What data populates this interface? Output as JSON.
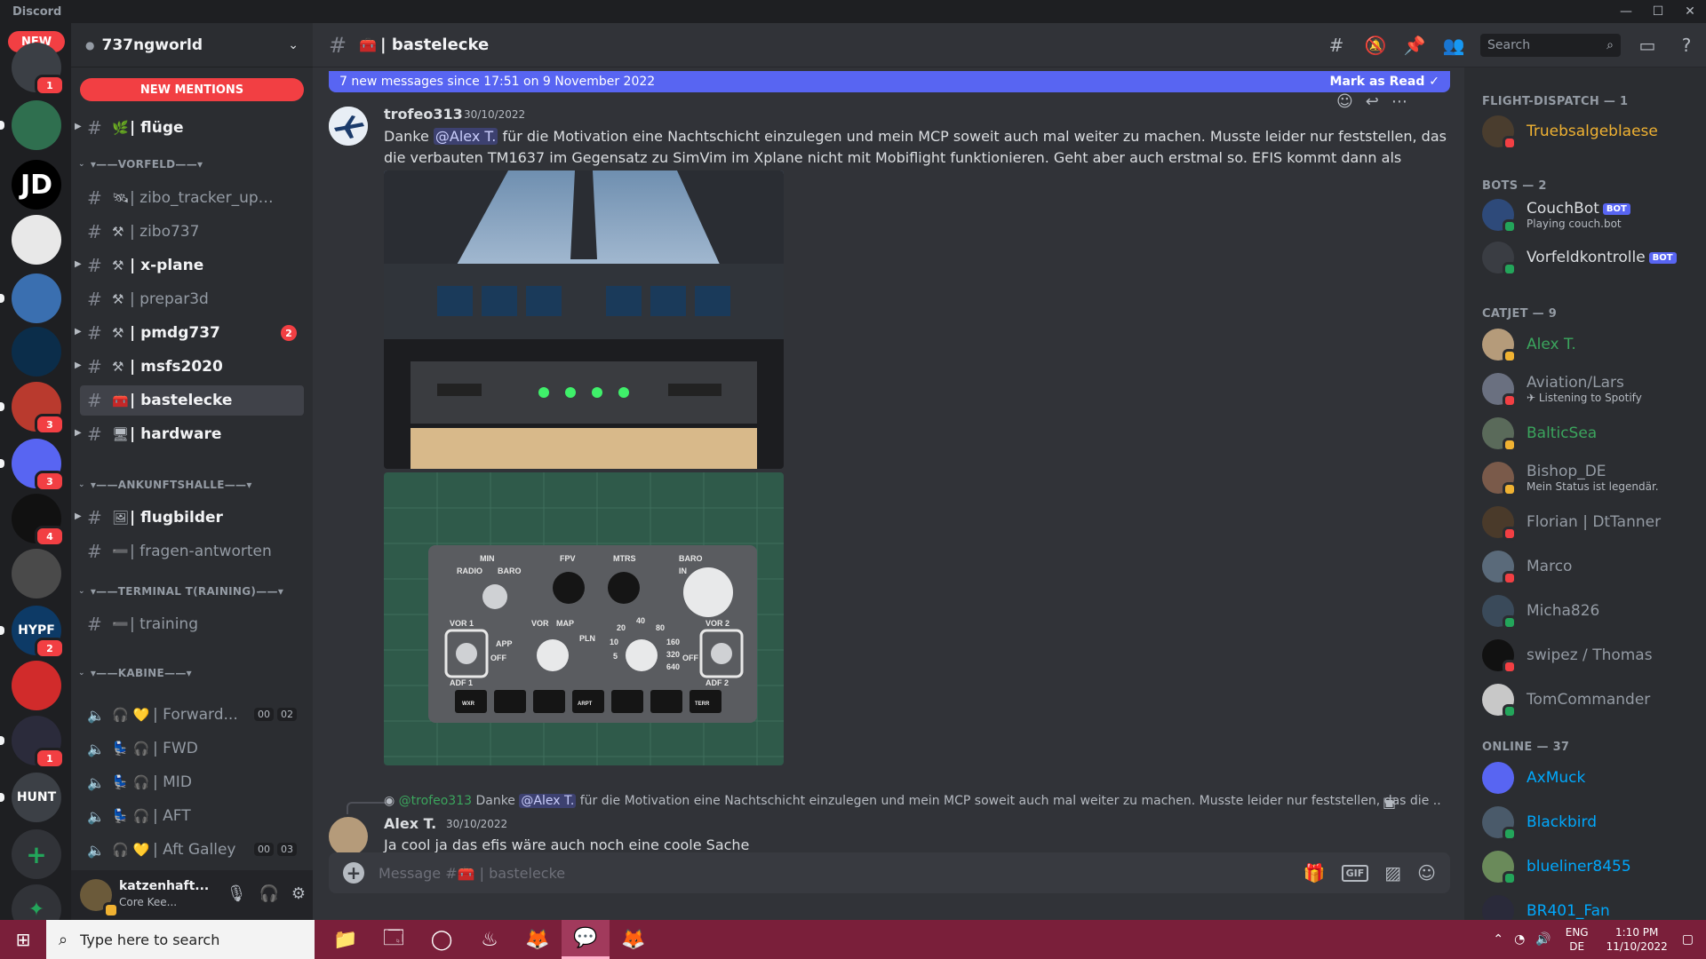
{
  "window": {
    "app_name": "Discord",
    "minimize": "—",
    "maximize": "☐",
    "close": "✕"
  },
  "rail": {
    "new_label": "NEW",
    "servers": [
      {
        "text": "",
        "color": "#3b3f45",
        "badge": "1"
      },
      {
        "text": "",
        "color": "#2f6f4f",
        "badge": ""
      },
      {
        "text": "JD",
        "color": "#000000",
        "badge": ""
      },
      {
        "text": "",
        "color": "#e8e8e8",
        "badge": ""
      },
      {
        "text": "",
        "color": "#3a6fb0",
        "badge": ""
      },
      {
        "text": "",
        "color": "#0b2d4a",
        "badge": ""
      },
      {
        "text": "",
        "color": "#b93a2e",
        "badge": "3"
      },
      {
        "text": "",
        "color": "#5865f2",
        "badge": "3"
      },
      {
        "text": "",
        "color": "#111111",
        "badge": "4"
      },
      {
        "text": "",
        "color": "#4a4a4a",
        "badge": ""
      },
      {
        "text": "HYPF",
        "color": "#0d3a66",
        "badge": "2"
      },
      {
        "text": "",
        "color": "#d12b2b",
        "badge": ""
      },
      {
        "text": "",
        "color": "#2b2b3b",
        "badge": "1"
      },
      {
        "text": "HUNT",
        "color": "#3c4046",
        "badge": ""
      }
    ],
    "add_server": "+",
    "explore": "✦"
  },
  "sidebar": {
    "guild_name": "737ngworld",
    "new_mentions": "NEW MENTIONS",
    "channels": [
      {
        "emoji": "🌿",
        "name": "flüge",
        "unread": true,
        "badge": ""
      },
      {
        "category": "VORFELD"
      },
      {
        "emoji": "🛰",
        "name": "zibo_tracker_upda...",
        "unread": false,
        "badge": ""
      },
      {
        "emoji": "⚒",
        "name": "zibo737",
        "unread": false,
        "badge": ""
      },
      {
        "emoji": "⚒",
        "name": "x-plane",
        "unread": true,
        "badge": ""
      },
      {
        "emoji": "⚒",
        "name": "prepar3d",
        "unread": false,
        "badge": ""
      },
      {
        "emoji": "⚒",
        "name": "pmdg737",
        "unread": true,
        "badge": "2"
      },
      {
        "emoji": "⚒",
        "name": "msfs2020",
        "unread": true,
        "badge": ""
      },
      {
        "emoji": "🧰",
        "name": "bastelecke",
        "active": true,
        "badge": ""
      },
      {
        "emoji": "🖥",
        "name": "hardware",
        "unread": true,
        "badge": ""
      },
      {
        "category": "ANKUNFTSHALLE"
      },
      {
        "emoji": "🖼",
        "name": "flugbilder",
        "unread": true,
        "badge": ""
      },
      {
        "emoji": "➖",
        "name": "fragen-antworten",
        "unread": false,
        "badge": ""
      },
      {
        "category": "TERMINAL T(RAINING)"
      },
      {
        "emoji": "➖",
        "name": "training",
        "unread": false,
        "badge": ""
      },
      {
        "category": "KABINE"
      }
    ],
    "voice": [
      {
        "emoji": "🎧 💛",
        "name": "Forward...",
        "count1": "00",
        "count2": "02"
      },
      {
        "emoji": "💺 🎧",
        "name": "FWD"
      },
      {
        "emoji": "💺 🎧",
        "name": "MID"
      },
      {
        "emoji": "💺 🎧",
        "name": "AFT"
      },
      {
        "emoji": "🎧 💛",
        "name": "Aft Galley",
        "count1": "00",
        "count2": "03"
      }
    ]
  },
  "user": {
    "name": "katzenhaft...",
    "status": "Core Kee...",
    "mic": "🎙",
    "headset": "🎧",
    "settings": "⚙"
  },
  "channel": {
    "name": "bastelecke",
    "emoji": "🧰",
    "hash": "#"
  },
  "header": {
    "search_placeholder": "Search",
    "tools": [
      "#",
      "🔕",
      "📌",
      "👥"
    ],
    "inbox": "▭",
    "help": "?"
  },
  "new_messages": {
    "text": "7 new messages since 17:51 on 9 November 2022",
    "mark_read": "Mark as Read"
  },
  "messages": [
    {
      "author": "trofeo313",
      "author_color": "#3ba55d",
      "timestamp": "30/10/2022",
      "text_pre": "Danke ",
      "mention": "@Alex T.",
      "text_post": " für die Motivation eine Nachtschicht einzulegen und mein MCP soweit auch mal weiter zu machen. Musste leider nur feststellen, das die verbauten TM1637 im Gegensatz zu SimVim im Xplane nicht mit Mobiflight funktionieren. Geht aber auch erstmal so. EFIS kommt dann als nächstes dran."
    },
    {
      "reply_author": "@trofeo313",
      "reply_pre": "Danke ",
      "reply_mention": "@Alex T.",
      "reply_post": " für die Motivation eine Nachtschicht einzulegen und mein MCP soweit auch mal weiter zu machen. Musste leider nur feststellen, das die ...",
      "author": "Alex T.",
      "author_color": "#3ba55d",
      "timestamp": "30/10/2022",
      "text": "Ja cool ja das efis wäre auch noch eine coole Sache"
    }
  ],
  "efis_labels": [
    "MIN",
    "RADIO",
    "BARO",
    "FPV",
    "MTRS",
    "BARO",
    "IN",
    "VOR 1",
    "OFF",
    "APP",
    "VOR",
    "MAP",
    "PLN",
    "20",
    "40",
    "80",
    "10",
    "160",
    "5",
    "320",
    "640",
    "OFF",
    "VOR 2",
    "ADF 1",
    "ADF 2",
    "WXR",
    "ARPT",
    "TERR"
  ],
  "composer": {
    "placeholder": "Message #🧰 | bastelecke",
    "gif": "GIF"
  },
  "members": {
    "groups": [
      {
        "title": "FLIGHT-DISPATCH — 1",
        "members": [
          {
            "name": "Truebsalgeblaese",
            "color": "#f0b232",
            "status": "dnd",
            "sub": "",
            "bot": false,
            "avatar": "#4a3d2e"
          }
        ]
      },
      {
        "title": "BOTS — 2",
        "members": [
          {
            "name": "CouchBot",
            "color": "#dbdee1",
            "status": "online",
            "sub": "Playing couch.bot",
            "bot": true,
            "avatar": "#2e4a7a"
          },
          {
            "name": "Vorfeldkontrolle",
            "color": "#dbdee1",
            "status": "online",
            "sub": "",
            "bot": true,
            "avatar": "#3a3d43"
          }
        ]
      },
      {
        "title": "CATJET — 9",
        "members": [
          {
            "name": "Alex T.",
            "color": "#3ba55d",
            "status": "idle",
            "sub": "",
            "bot": false,
            "avatar": "#b59b7a"
          },
          {
            "name": "Aviation/Lars",
            "color": "#949ba4",
            "status": "dnd",
            "sub": "✈ Listening to Spotify",
            "bot": false,
            "avatar": "#6a7080"
          },
          {
            "name": "BalticSea",
            "color": "#3ba55d",
            "status": "idle",
            "sub": "",
            "bot": false,
            "avatar": "#5a6a5a"
          },
          {
            "name": "Bishop_DE",
            "color": "#949ba4",
            "status": "idle",
            "sub": "Mein Status ist legendär.",
            "bot": false,
            "avatar": "#7a5a4a"
          },
          {
            "name": "Florian | DtTanner",
            "color": "#949ba4",
            "status": "dnd",
            "sub": "",
            "bot": false,
            "avatar": "#4a3a2a"
          },
          {
            "name": "Marco",
            "color": "#949ba4",
            "status": "dnd",
            "sub": "",
            "bot": false,
            "avatar": "#5a6a7a"
          },
          {
            "name": "Micha826",
            "color": "#949ba4",
            "status": "online",
            "sub": "",
            "bot": false,
            "avatar": "#3a4a5a"
          },
          {
            "name": "swipez / Thomas",
            "color": "#949ba4",
            "status": "dnd",
            "sub": "",
            "bot": false,
            "avatar": "#111111"
          },
          {
            "name": "TomCommander",
            "color": "#949ba4",
            "status": "online",
            "sub": "",
            "bot": false,
            "avatar": "#c8c8c8"
          }
        ]
      },
      {
        "title": "ONLINE — 37",
        "members": [
          {
            "name": "AxMuck",
            "color": "#00a8fc",
            "status": "",
            "sub": "",
            "bot": false,
            "avatar": "#5865f2"
          },
          {
            "name": "Blackbird",
            "color": "#00a8fc",
            "status": "online",
            "sub": "",
            "bot": false,
            "avatar": "#4a5a6a"
          },
          {
            "name": "blueliner8455",
            "color": "#00a8fc",
            "status": "online",
            "sub": "",
            "bot": false,
            "avatar": "#6a8a5a"
          },
          {
            "name": "BR401_Fan",
            "color": "#00a8fc",
            "status": "",
            "sub": "",
            "bot": false,
            "avatar": "#2a2a3a"
          }
        ]
      }
    ]
  },
  "taskbar": {
    "search_placeholder": "Type here to search",
    "apps": [
      "📁",
      "🗔",
      "◯",
      "♨",
      "🦊",
      "💬",
      "🦊"
    ],
    "lang_top": "ENG",
    "lang_bottom": "DE",
    "time": "1:10 PM",
    "date": "11/10/2022"
  },
  "colors": {
    "accent": "#5865f2",
    "danger": "#f23f43",
    "online": "#23a55a",
    "idle": "#f0b232",
    "taskbar": "#7a1f3a"
  }
}
